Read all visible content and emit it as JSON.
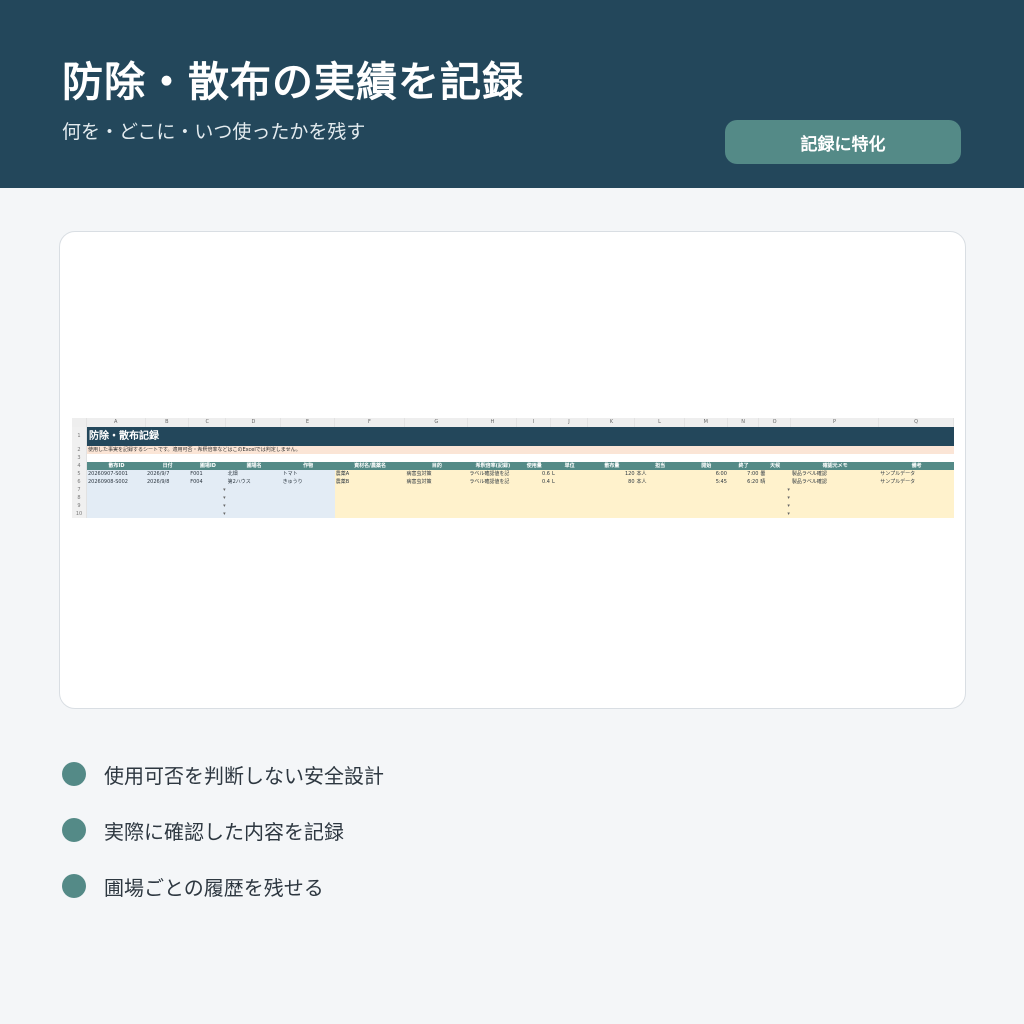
{
  "header": {
    "title": "防除・散布の実績を記録",
    "subtitle": "何を・どこに・いつ使ったかを残す",
    "badge": "記録に特化"
  },
  "sheet": {
    "columns": [
      "A",
      "B",
      "C",
      "D",
      "E",
      "F",
      "G",
      "H",
      "I",
      "J",
      "K",
      "L",
      "M",
      "N",
      "O",
      "P",
      "Q"
    ],
    "row_numbers": [
      "1",
      "2",
      "3",
      "4",
      "5",
      "6",
      "7",
      "8",
      "9",
      "10"
    ],
    "title": "防除・散布記録",
    "note": "使用した事実を記録するシートです。適用可否・希釈倍率などはこのExcelでは判定しません。",
    "headers": [
      "散布ID",
      "日付",
      "圃場ID",
      "圃場名",
      "作物",
      "資材名/農薬名",
      "目的",
      "希釈倍率(記録)",
      "使用量",
      "単位",
      "散布量",
      "担当",
      "開始",
      "終了",
      "天候",
      "確認元メモ",
      "備考"
    ],
    "rows": [
      [
        "20260907-S001",
        "2026/9/7",
        "F001",
        "北畑",
        "トマト",
        "農薬A",
        "病害虫対策",
        "ラベル確認値を記",
        "0.6",
        "L",
        "120",
        "本人",
        "6:00",
        "7:00",
        "曇",
        "製品ラベル確認",
        "サンプルデータ"
      ],
      [
        "20260908-S002",
        "2026/9/8",
        "F004",
        "第2ハウス",
        "きゅうり",
        "農薬B",
        "病害虫対策",
        "ラベル確認値を記",
        "0.4",
        "L",
        "80",
        "本人",
        "5:45",
        "6:20",
        "晴",
        "製品ラベル確認",
        "サンプルデータ"
      ]
    ],
    "dropdown_glyph": "▾"
  },
  "features": [
    {
      "text": "使用可否を判断しない安全設計",
      "icon": "bullet-dot"
    },
    {
      "text": "実際に確認した内容を記録",
      "icon": "bullet-dot"
    },
    {
      "text": "圃場ごとの履歴を残せる",
      "icon": "bullet-dot"
    }
  ],
  "colors": {
    "header_bg": "#23475b",
    "accent": "#548a87",
    "page_bg": "#f4f6f8",
    "note_bg": "#fbe5d6",
    "input_blue": "#e3ecf5",
    "input_yellow": "#fff2cc"
  }
}
